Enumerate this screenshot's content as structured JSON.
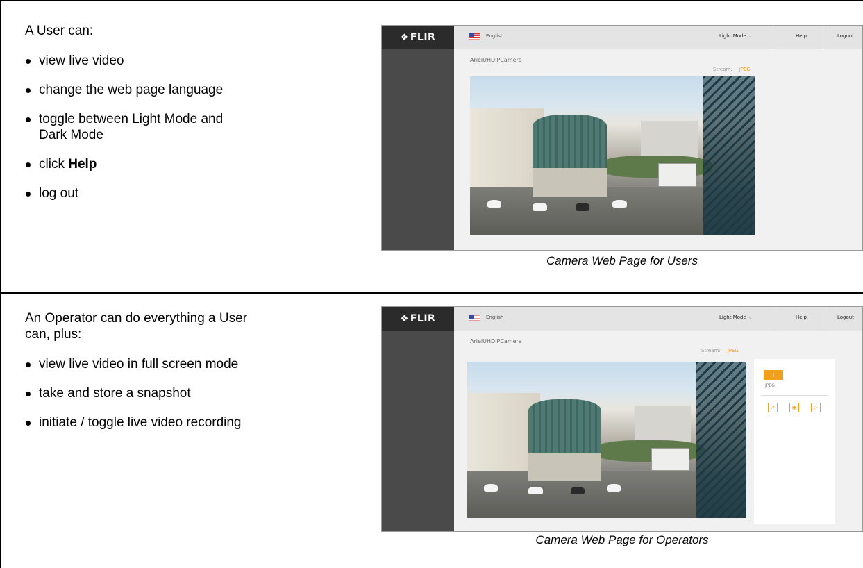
{
  "rows": [
    {
      "intro": "A User can:",
      "bullets": [
        {
          "text": "view live video"
        },
        {
          "text": "change the web page language"
        },
        {
          "text": "toggle between Light Mode and Dark Mode"
        },
        {
          "prefix": "click ",
          "bold": "Help"
        },
        {
          "text": "log out"
        }
      ],
      "caption": "Camera Web Page for Users"
    },
    {
      "intro": "An Operator can do everything a User can, plus:",
      "bullets": [
        {
          "text": "view live video in full screen mode"
        },
        {
          "text": "take and store a snapshot"
        },
        {
          "text": "initiate / toggle live video recording"
        }
      ],
      "caption": "Camera Web Page for Operators"
    }
  ],
  "camera_ui": {
    "logo": "FLIR",
    "logo_icon": "flir-diamond-icon",
    "language": "English",
    "flag_icon": "us-flag-icon",
    "mode": "Light Mode",
    "help": "Help",
    "logout": "Logout",
    "camera_name": "ArielUHDIPCamera",
    "stream_label": "Stream:",
    "stream_value": "JPEG",
    "operator_panel": {
      "stream_button": "J",
      "stream_button_label": "JPEG",
      "icons": [
        "fullscreen-icon",
        "snapshot-icon",
        "record-icon"
      ]
    },
    "accent_color": "#f2a01c"
  }
}
